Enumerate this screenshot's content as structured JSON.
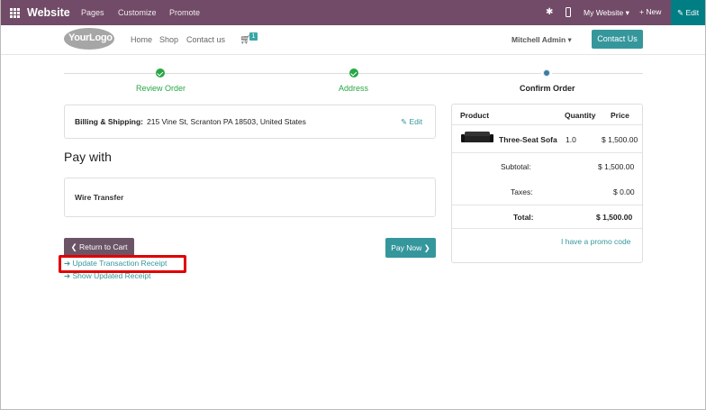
{
  "topbar": {
    "brand": "Website",
    "menu": [
      "Pages",
      "Customize",
      "Promote"
    ],
    "my_website": "My Website ▾",
    "new": "+ New",
    "edit": "✎ Edit"
  },
  "header": {
    "logo_text": "YourLogo",
    "nav": [
      "Home",
      "Shop",
      "Contact us"
    ],
    "cart_count": "1",
    "user": "Mitchell Admin ▾",
    "contact_button": "Contact Us"
  },
  "progress": {
    "steps": [
      {
        "label": "Review Order",
        "state": "done"
      },
      {
        "label": "Address",
        "state": "done"
      },
      {
        "label": "Confirm Order",
        "state": "current"
      }
    ]
  },
  "billing": {
    "label": "Billing & Shipping:",
    "address": "215 Vine St, Scranton PA 18503, United States",
    "edit": "✎ Edit"
  },
  "payment": {
    "title": "Pay with",
    "method": "Wire Transfer",
    "return_button": "❮ Return to Cart",
    "pay_button": "Pay Now ❯",
    "links": [
      "➔ Update Transaction Receipt",
      "➔ Show Updated Receipt"
    ]
  },
  "summary": {
    "headers": {
      "product": "Product",
      "quantity": "Quantity",
      "price": "Price"
    },
    "item": {
      "name": "Three-Seat Sofa",
      "quantity": "1.0",
      "price": "$ 1,500.00"
    },
    "subtotal_label": "Subtotal:",
    "subtotal": "$ 1,500.00",
    "taxes_label": "Taxes:",
    "taxes": "$ 0.00",
    "total_label": "Total:",
    "total": "$ 1,500.00",
    "promo": "I have a promo code"
  },
  "colors": {
    "admin_bar": "#714b67",
    "edit_button": "#017e84",
    "accent": "#35979c",
    "success": "#28a745",
    "highlight": "#e00000"
  }
}
